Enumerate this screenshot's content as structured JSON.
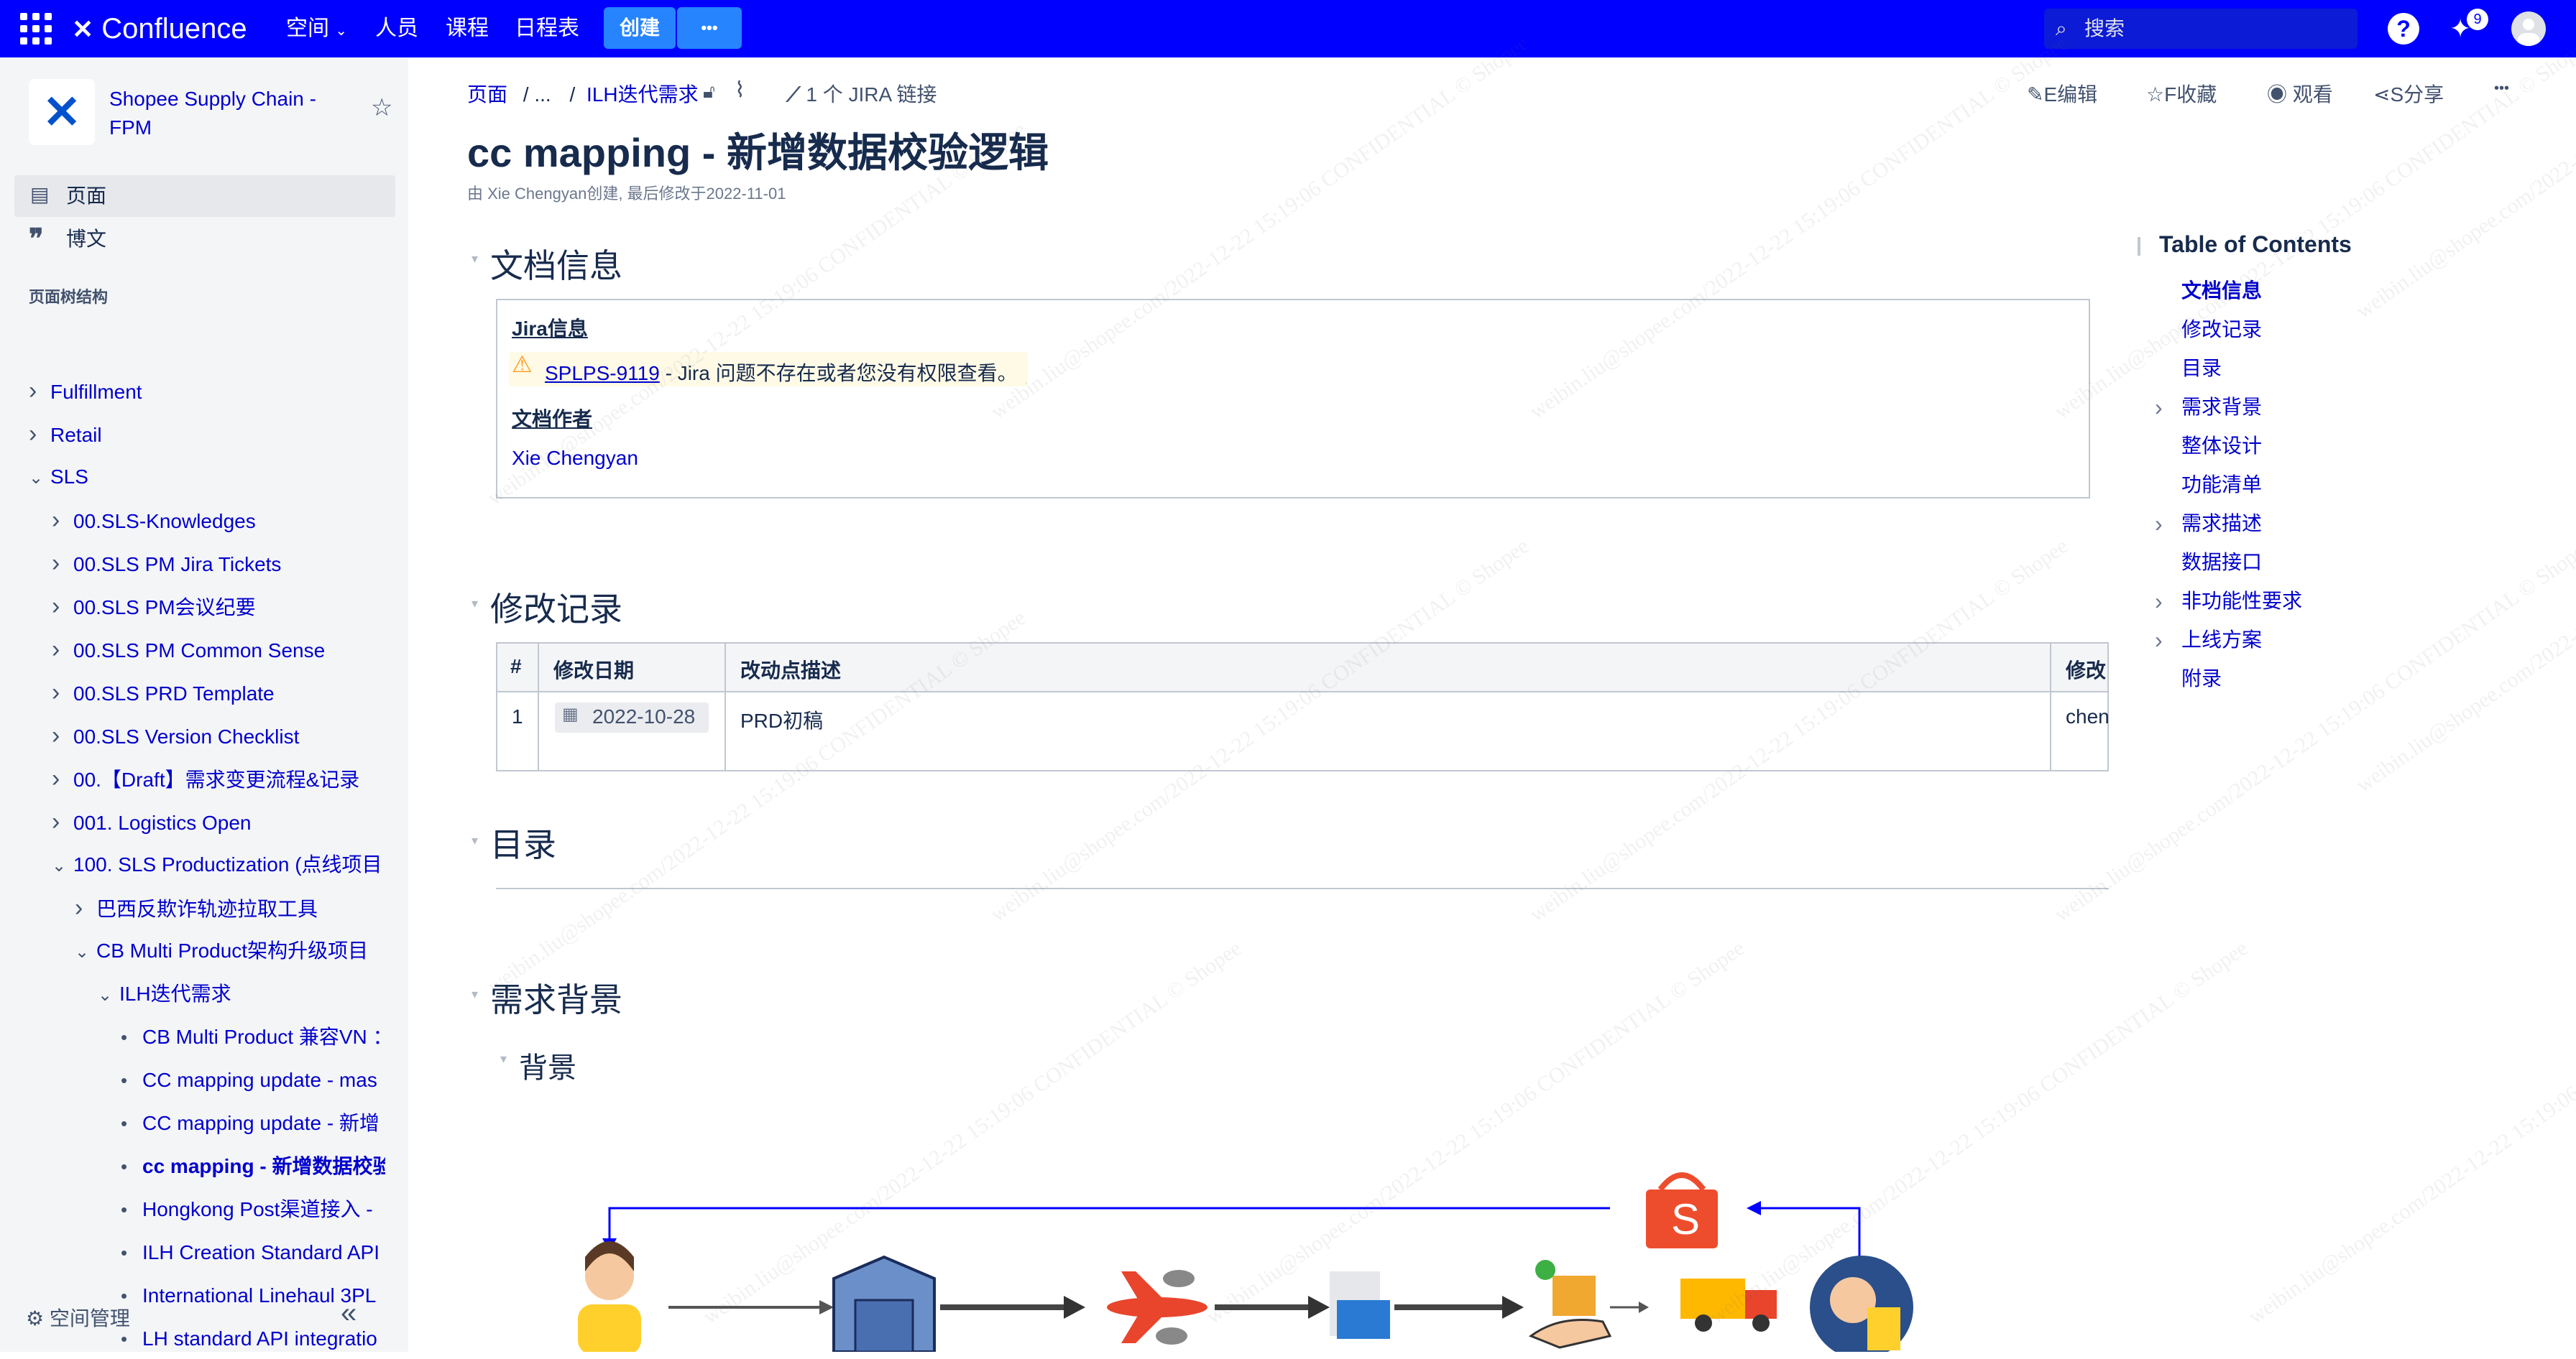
{
  "topbar": {
    "brand": "Confluence",
    "nav": [
      "空间",
      "人员",
      "课程",
      "日程表"
    ],
    "create": "创建",
    "more": "•••",
    "search_placeholder": "搜索",
    "notif_count": "9"
  },
  "sidebar": {
    "space_name": "Shopee Supply Chain - FPM",
    "pages": "页面",
    "blog": "博文",
    "tree_title": "页面树结构",
    "tree": [
      {
        "label": "Fulfillment",
        "marker": "chev-right"
      },
      {
        "label": "Retail",
        "marker": "chev-right"
      },
      {
        "label": "SLS",
        "marker": "chev-down"
      },
      {
        "label": "00.SLS-Knowledges",
        "marker": "chev-right"
      },
      {
        "label": "00.SLS PM Jira Tickets",
        "marker": "chev-right"
      },
      {
        "label": "00.SLS PM会议纪要",
        "marker": "chev-right"
      },
      {
        "label": "00.SLS PM Common Sense",
        "marker": "chev-right"
      },
      {
        "label": "00.SLS PRD Template",
        "marker": "chev-right"
      },
      {
        "label": "00.SLS Version Checklist",
        "marker": "chev-right"
      },
      {
        "label": "00.【Draft】需求变更流程&记录",
        "marker": "chev-right"
      },
      {
        "label": "001. Logistics Open",
        "marker": "chev-right"
      },
      {
        "label": "100. SLS Productization (点线项目",
        "marker": "chev-down"
      },
      {
        "label": "巴西反欺诈轨迹拉取工具",
        "marker": "chev-right"
      },
      {
        "label": "CB Multi Product架构升级项目",
        "marker": "chev-down"
      },
      {
        "label": "ILH迭代需求",
        "marker": "chev-down"
      },
      {
        "label": "CB Multi Product 兼容VN ：",
        "marker": "dot"
      },
      {
        "label": "CC mapping update - mas",
        "marker": "dot"
      },
      {
        "label": "CC mapping update - 新增",
        "marker": "dot"
      },
      {
        "label": "cc mapping - 新增数据校验",
        "marker": "dot",
        "current": true
      },
      {
        "label": "Hongkong Post渠道接入 -",
        "marker": "dot"
      },
      {
        "label": "ILH Creation Standard API",
        "marker": "dot"
      },
      {
        "label": "International Linehaul 3PL",
        "marker": "dot"
      },
      {
        "label": "LH standard API integratio",
        "marker": "dot"
      }
    ],
    "space_admin": "空间管理",
    "collapse": "«"
  },
  "page": {
    "breadcrumb": [
      "页面",
      "/ ...",
      "/",
      "ILH迭代需求"
    ],
    "jira_links": "1 个 JIRA 链接",
    "actions": {
      "edit": "E编辑",
      "fav": "F收藏",
      "watch": "观看",
      "share": "S分享",
      "more": "•••"
    },
    "title": "cc mapping - 新增数据校验逻辑",
    "byline": "由 Xie Chengyan创建, 最后修改于2022-11-01",
    "sections": {
      "doc_info": "文档信息",
      "revisions": "修改记录",
      "toc": "目录",
      "background": "需求背景",
      "sub_background": "背景"
    },
    "info_panel": {
      "jira_heading": "Jira信息",
      "jira_key": "SPLPS-9119",
      "jira_msg": " - Jira 问题不存在或者您没有权限查看。",
      "author_heading": "文档作者",
      "author": "Xie Chengyan"
    },
    "revision_table": {
      "headers": [
        "#",
        "修改日期",
        "改动点描述",
        "修改"
      ],
      "rows": [
        [
          "1",
          "2022-10-28",
          "PRD初稿",
          "chen"
        ]
      ]
    }
  },
  "toc": {
    "title": "Table of Contents",
    "items": [
      {
        "label": "文档信息",
        "bold": true
      },
      {
        "label": "修改记录"
      },
      {
        "label": "目录"
      },
      {
        "label": "需求背景",
        "expand": true
      },
      {
        "label": "整体设计"
      },
      {
        "label": "功能清单"
      },
      {
        "label": "需求描述",
        "expand": true
      },
      {
        "label": "数据接口"
      },
      {
        "label": "非功能性要求",
        "expand": true
      },
      {
        "label": "上线方案",
        "expand": true
      },
      {
        "label": "附录"
      }
    ]
  },
  "watermark": "weibin.liu@shopee.com/2022-12-22 15:19:06 CONFIDENTIAL © Shopee",
  "colors": {
    "topbar": "#0000ff",
    "link": "#0000cc",
    "sidebar_bg": "#f4f5f7",
    "create_btn": "#2684ff"
  },
  "icons": [
    "apps-grid-icon",
    "confluence-logo-icon",
    "search-icon",
    "help-icon",
    "notification-icon",
    "avatar-icon",
    "star-icon",
    "page-icon",
    "quote-icon",
    "gear-icon",
    "pencil-icon",
    "eye-icon",
    "share-icon",
    "lock-icon",
    "attachment-icon",
    "jira-icon",
    "warning-icon",
    "calendar-icon"
  ]
}
